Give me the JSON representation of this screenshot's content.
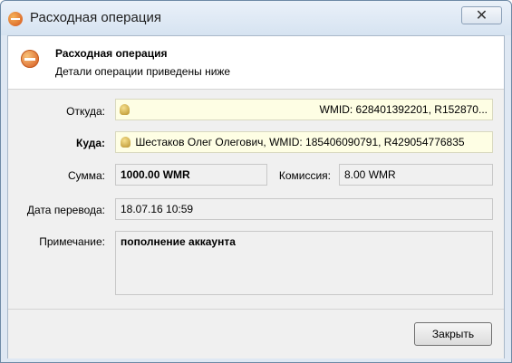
{
  "window": {
    "title": "Расходная операция",
    "close_glyph": "✕"
  },
  "header": {
    "title": "Расходная операция",
    "subtitle": "Детали операции приведены ниже"
  },
  "form": {
    "from_label": "Откуда:",
    "from_value": "WMID: 628401392201, R152870...",
    "to_label": "Куда:",
    "to_value": "Шестаков Олег Олегович, WMID: 185406090791, R429054776835",
    "amount_label": "Сумма:",
    "amount_value": "1000.00 WMR",
    "fee_label": "Комиссия:",
    "fee_value": "8.00 WMR",
    "date_label": "Дата перевода:",
    "date_value": "18.07.16 10:59",
    "note_label": "Примечание:",
    "note_value": "пополнение аккаунта"
  },
  "buttons": {
    "close_label": "Закрыть"
  },
  "icons": {
    "title": "minus-circle-icon",
    "header": "minus-circle-icon",
    "wallet": "webmoney-user-icon"
  }
}
